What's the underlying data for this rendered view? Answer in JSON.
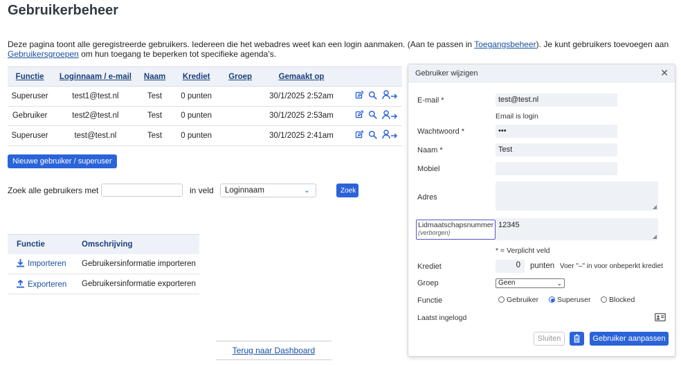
{
  "page": {
    "title": "Gebruikerbeheer",
    "intro_part1": "Deze pagina toont alle geregistreerde gebruikers. Iedereen die het webadres weet kan een login aanmaken. (Aan te passen in ",
    "intro_link1": "Toegangsbeheer",
    "intro_part2": "). Je kunt gebruikers toevoegen aan ",
    "intro_link2": "Gebruikersgroepen",
    "intro_part3": " om hun toegang te beperken tot specifieke agenda’s."
  },
  "users_table": {
    "headers": [
      "Functie",
      "Loginnaam / e-mail",
      "Naam",
      "Krediet",
      "Groep",
      "Gemaakt op"
    ],
    "rows": [
      {
        "functie": "Superuser",
        "login": "test1@test.nl",
        "naam": "Test",
        "krediet": "0 punten",
        "groep": "",
        "gemaakt": "30/1/2025 2:52am"
      },
      {
        "functie": "Gebruiker",
        "login": "test2@test.nl",
        "naam": "Test",
        "krediet": "0 punten",
        "groep": "",
        "gemaakt": "30/1/2025 2:53am"
      },
      {
        "functie": "Superuser",
        "login": "test@test.nl",
        "naam": "Test",
        "krediet": "0 punten",
        "groep": "",
        "gemaakt": "30/1/2025 2:41am"
      }
    ],
    "action_icons": [
      "edit-icon",
      "search-icon",
      "user-switch-icon"
    ]
  },
  "new_user_button": "Nieuwe gebruiker / superuser",
  "search": {
    "label": "Zoek alle gebruikers met",
    "value": "",
    "field_label": "in veld",
    "field_selected": "Loginnaam",
    "button": "Zoek"
  },
  "function_table": {
    "headers": [
      "Functie",
      "Omschrijving"
    ],
    "rows": [
      {
        "label": "Importeren",
        "icon": "download-icon",
        "description": "Gebruikersinformatie importeren"
      },
      {
        "label": "Exporteren",
        "icon": "upload-icon",
        "description": "Gebruikersinformatie exporteren"
      }
    ]
  },
  "back_link": "Terug naar Dashboard",
  "modal": {
    "title": "Gebruiker wijzigen",
    "email_label": "E-mail *",
    "email_value": "test@test.nl",
    "email_note": "Email is login",
    "password_label": "Wachtwoord *",
    "password_value": "•••",
    "name_label": "Naam *",
    "name_value": "Test",
    "mobile_label": "Mobiel",
    "mobile_value": "",
    "address_label": "Adres",
    "address_value": "",
    "membership_label": "Lidmaatschapsnummer",
    "membership_sub": "(verborgen)",
    "membership_value": "12345",
    "required_note": "* = Verplicht veld",
    "credit_label": "Krediet",
    "credit_value": "0",
    "credit_unit": "punten",
    "credit_note": "Voer \"–\" in voor onbeperkt krediet",
    "group_label": "Groep",
    "group_value": "Geen",
    "role_label": "Functie",
    "roles": [
      {
        "label": "Gebruiker",
        "selected": false
      },
      {
        "label": "Superuser",
        "selected": true
      },
      {
        "label": "Blocked",
        "selected": false
      }
    ],
    "last_login_label": "Laatst ingelogd",
    "close_button": "Sluiten",
    "save_button": "Gebruiker aanpassen"
  },
  "colors": {
    "accent": "#2b63d9",
    "header_bg": "#eef2f8",
    "link": "#1a4fa0"
  }
}
